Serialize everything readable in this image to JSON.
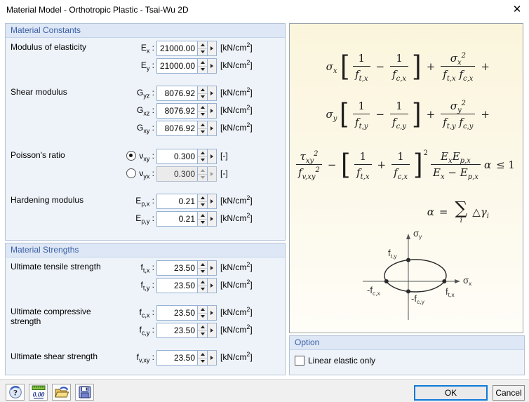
{
  "window": {
    "title": "Material Model - Orthotropic Plastic - Tsai-Wu 2D",
    "close": "✕"
  },
  "constants": {
    "title": "Material Constants",
    "row_labels": {
      "modulus": "Modulus of elasticity",
      "shear": "Shear modulus",
      "poisson": "Poisson's ratio",
      "hardening": "Hardening modulus"
    },
    "fields": {
      "ex": {
        "sym": "E<sub>x</sub> :",
        "value": "21000.00",
        "unit": "[kN/cm<sup>2</sup>]"
      },
      "ey": {
        "sym": "E<sub>y</sub> :",
        "value": "21000.00",
        "unit": "[kN/cm<sup>2</sup>]"
      },
      "gyz": {
        "sym": "G<sub>yz</sub> :",
        "value": "8076.92",
        "unit": "[kN/cm<sup>2</sup>]"
      },
      "gxz": {
        "sym": "G<sub>xz</sub> :",
        "value": "8076.92",
        "unit": "[kN/cm<sup>2</sup>]"
      },
      "gxy": {
        "sym": "G<sub>xy</sub> :",
        "value": "8076.92",
        "unit": "[kN/cm<sup>2</sup>]"
      },
      "vxy": {
        "sym": "ν<sub>xy</sub> :",
        "value": "0.300",
        "unit": "[-]"
      },
      "vyx": {
        "sym": "ν<sub>yx</sub> :",
        "value": "0.300",
        "unit": "[-]"
      },
      "epx": {
        "sym": "E<sub>p,x</sub> :",
        "value": "0.21",
        "unit": "[kN/cm<sup>2</sup>]"
      },
      "epy": {
        "sym": "E<sub>p,y</sub> :",
        "value": "0.21",
        "unit": "[kN/cm<sup>2</sup>]"
      }
    }
  },
  "strengths": {
    "title": "Material Strengths",
    "row_labels": {
      "tensile": "Ultimate tensile strength",
      "compressive": "Ultimate compressive strength",
      "shear": "Ultimate shear strength"
    },
    "fields": {
      "ftx": {
        "sym": "f<sub>t,x</sub> :",
        "value": "23.50",
        "unit": "[kN/cm<sup>2</sup>]"
      },
      "fty": {
        "sym": "f<sub>t,y</sub> :",
        "value": "23.50",
        "unit": "[kN/cm<sup>2</sup>]"
      },
      "fcx": {
        "sym": "f<sub>c,x</sub> :",
        "value": "23.50",
        "unit": "[kN/cm<sup>2</sup>]"
      },
      "fcy": {
        "sym": "f<sub>c,y</sub> :",
        "value": "23.50",
        "unit": "[kN/cm<sup>2</sup>]"
      },
      "fvxy": {
        "sym": "f<sub>v,xy</sub> :",
        "value": "23.50",
        "unit": "[kN/cm<sup>2</sup>]"
      }
    }
  },
  "formula": {
    "line1": {
      "lead": "σ<sub>x</sub>",
      "f1n": "1",
      "f1d": "f<sub>t,x</sub>",
      "op1": "−",
      "f2n": "1",
      "f2d": "f<sub>c,x</sub>",
      "op2": "+",
      "f3n": "σ<sub>x</sub><sup>2</sup>",
      "f3d": "f<sub>t,x</sub> f<sub>c,x</sub>",
      "trail": "+"
    },
    "line2": {
      "lead": "σ<sub>y</sub>",
      "f1n": "1",
      "f1d": "f<sub>t,y</sub>",
      "op1": "−",
      "f2n": "1",
      "f2d": "f<sub>c,y</sub>",
      "op2": "+",
      "f3n": "σ<sub>y</sub><sup>2</sup>",
      "f3d": "f<sub>t,y</sub> f<sub>c,y</sub>",
      "trail": "+"
    },
    "line3": {
      "f0n": "τ<sub>xy</sub><sup>2</sup>",
      "f0d": "f<sub>v,xy</sub><sup>2</sup>",
      "op1": "−",
      "f1n": "1",
      "f1d": "f<sub>t,x</sub>",
      "op2": "+",
      "f2n": "1",
      "f2d": "f<sub>c,x</sub>",
      "exp": "2",
      "f3n": "E<sub>x</sub>E<sub>p,x</sub>",
      "f3d": "E<sub>x</sub> − E<sub>p,x</sub>",
      "alpha": "α",
      "cmp": "≤ 1"
    },
    "line4": {
      "lhs": "α",
      "eq": "=",
      "sum": "∑",
      "sub": "i",
      "rhs": "△γ<sub>i</sub>"
    }
  },
  "diagram": {
    "sigma_y": "σ<sub>y</sub>",
    "sigma_x": "σ<sub>x</sub>",
    "f_ty": "f<sub>t,y</sub>",
    "f_tx": "f<sub>t,x</sub>",
    "f_cx": "-f<sub>c,x</sub>",
    "f_cy": "-f<sub>c,y</sub>"
  },
  "option": {
    "title": "Option",
    "linear_elastic_label": "Linear elastic only",
    "checked": false
  },
  "toolbar": {
    "units_text": "0.00"
  },
  "buttons": {
    "ok": "OK",
    "cancel": "Cancel"
  }
}
